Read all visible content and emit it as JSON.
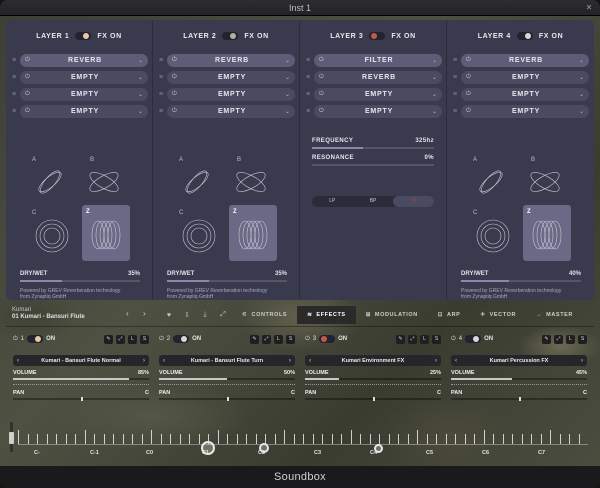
{
  "window": {
    "title": "Inst 1",
    "close": "✕"
  },
  "fx_layers": [
    {
      "name": "LAYER 1",
      "fx_on": "FX ON",
      "slots": [
        {
          "name": "REVERB"
        },
        {
          "name": "EMPTY"
        },
        {
          "name": "EMPTY"
        },
        {
          "name": "EMPTY"
        }
      ],
      "xy_labels": {
        "a": "A",
        "b": "B",
        "c": "C",
        "z": "Z"
      },
      "drywet": {
        "label": "DRY/WET",
        "value": "35%",
        "fraction": 0.35
      },
      "powered": "Powered by GREV Reverberation technology\nfrom Zynaptiq GmbH",
      "logo_text": "zynaptiq"
    },
    {
      "name": "LAYER 2",
      "fx_on": "FX ON",
      "slots": [
        {
          "name": "REVERB"
        },
        {
          "name": "EMPTY"
        },
        {
          "name": "EMPTY"
        },
        {
          "name": "EMPTY"
        }
      ],
      "xy_labels": {
        "a": "A",
        "b": "B",
        "c": "C",
        "z": "Z"
      },
      "drywet": {
        "label": "DRY/WET",
        "value": "35%",
        "fraction": 0.35
      },
      "powered": "Powered by GREV Reverberation technology\nfrom Zynaptiq GmbH",
      "logo_text": "zynaptiq"
    },
    {
      "name": "LAYER 3",
      "fx_on": "FX ON",
      "slots": [
        {
          "name": "FILTER"
        },
        {
          "name": "REVERB"
        },
        {
          "name": "EMPTY"
        },
        {
          "name": "EMPTY"
        }
      ],
      "params": [
        {
          "label": "FREQUENCY",
          "value": "325hz",
          "fraction": 0.42
        },
        {
          "label": "RESONANCE",
          "value": "0%",
          "fraction": 0.0
        }
      ],
      "filter_modes": [
        "LP",
        "BP",
        "HP"
      ],
      "filter_selected": "HP"
    },
    {
      "name": "LAYER 4",
      "fx_on": "FX ON",
      "slots": [
        {
          "name": "REVERB"
        },
        {
          "name": "EMPTY"
        },
        {
          "name": "EMPTY"
        },
        {
          "name": "EMPTY"
        }
      ],
      "xy_labels": {
        "a": "A",
        "b": "B",
        "c": "C",
        "z": "Z"
      },
      "drywet": {
        "label": "DRY/WET",
        "value": "40%",
        "fraction": 0.4
      },
      "powered": "Powered by GREV Reverberation technology\nfrom Zynaptiq GmbH",
      "logo_text": "zynaptiq"
    }
  ],
  "preset": {
    "bank": "Kumari",
    "name": "01 Kumari - Bansuri Flute"
  },
  "nav": {
    "prev": "‹",
    "next": "›"
  },
  "tabs": [
    {
      "label": "CONTROLS",
      "active": false
    },
    {
      "label": "EFFECTS",
      "active": true
    },
    {
      "label": "MODULATION",
      "active": false
    },
    {
      "label": "ARP",
      "active": false
    },
    {
      "label": "VECTOR",
      "active": false
    },
    {
      "label": "MASTER",
      "active": false
    }
  ],
  "sources": [
    {
      "num": "1",
      "on": "ON",
      "preset": "Kumari - Bansuri Flute Normal",
      "volume_label": "VOLUME",
      "volume": "85%",
      "volume_fraction": 0.85,
      "pan_label": "PAN",
      "pan": "C"
    },
    {
      "num": "2",
      "on": "ON",
      "preset": "Kumari - Bansuri Flute Turn",
      "volume_label": "VOLUME",
      "volume": "50%",
      "volume_fraction": 0.5,
      "pan_label": "PAN",
      "pan": "C"
    },
    {
      "num": "3",
      "on": "ON",
      "preset": "Kumari Environment FX",
      "volume_label": "VOLUME",
      "volume": "25%",
      "volume_fraction": 0.25,
      "pan_label": "PAN",
      "pan": "C"
    },
    {
      "num": "4",
      "on": "ON",
      "preset": "Kumari Percussion FX",
      "volume_label": "VOLUME",
      "volume": "45%",
      "volume_fraction": 0.45,
      "pan_label": "PAN",
      "pan": "C"
    }
  ],
  "mini_buttons": [
    "✎",
    "⤢",
    "L",
    "S"
  ],
  "keyboard": {
    "octaves": [
      "C-",
      "C-1",
      "C0",
      "C1",
      "C2",
      "C3",
      "C4",
      "C5",
      "C6",
      "C7"
    ]
  },
  "brand": "Soundbox",
  "colors": {
    "panel": "#3a3a4e",
    "accent": "#e8c9a8",
    "filter_active": "#8f4c48"
  }
}
